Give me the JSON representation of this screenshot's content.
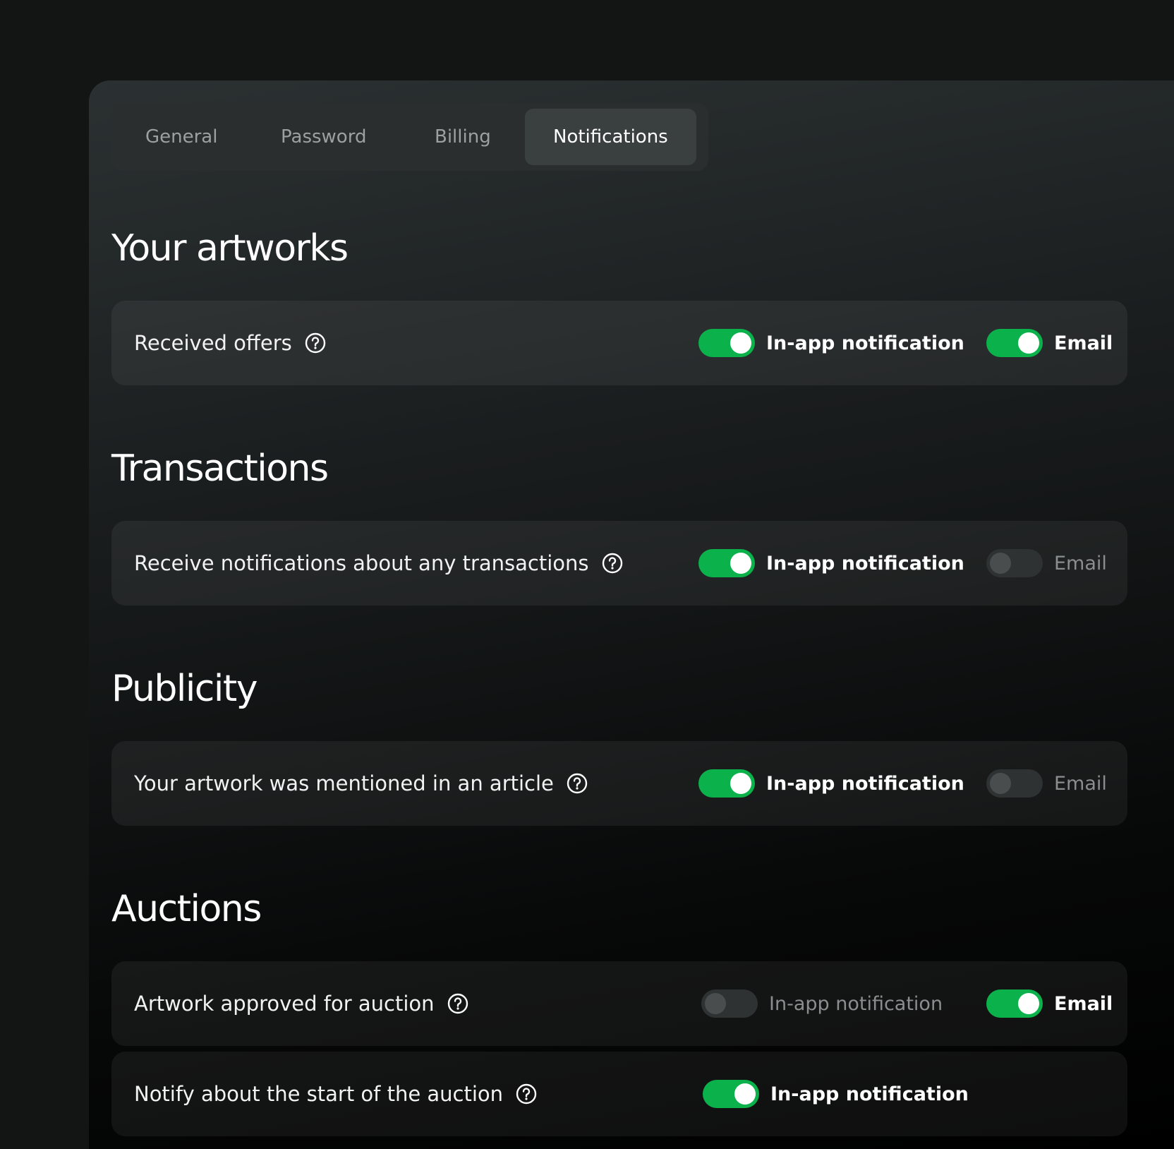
{
  "tabs": [
    {
      "label": "General",
      "active": false
    },
    {
      "label": "Password",
      "active": false
    },
    {
      "label": "Billing",
      "active": false
    },
    {
      "label": "Notifications",
      "active": true
    }
  ],
  "colors": {
    "toggle_on": "#0bb24b",
    "toggle_off": "#2f3233",
    "text_primary": "#ffffff",
    "text_muted": "#8a8e8f"
  },
  "icons": {
    "help": "question-circle-icon"
  },
  "sections": [
    {
      "title": "Your artworks",
      "rows": [
        {
          "label": "Received offers",
          "in_app": {
            "label": "In-app notification",
            "on": true
          },
          "email": {
            "label": "Email",
            "on": true
          }
        }
      ]
    },
    {
      "title": "Transactions",
      "rows": [
        {
          "label": "Receive notifications about any transactions",
          "in_app": {
            "label": "In-app notification",
            "on": true
          },
          "email": {
            "label": "Email",
            "on": false
          }
        }
      ]
    },
    {
      "title": "Publicity",
      "rows": [
        {
          "label": "Your artwork was mentioned in an article",
          "in_app": {
            "label": "In-app notification",
            "on": true
          },
          "email": {
            "label": "Email",
            "on": false
          }
        }
      ]
    },
    {
      "title": "Auctions",
      "rows": [
        {
          "label": "Artwork approved for auction",
          "in_app": {
            "label": "In-app notification",
            "on": false
          },
          "email": {
            "label": "Email",
            "on": true
          }
        },
        {
          "label": "Notify about the start of the auction",
          "in_app": {
            "label": "In-app notification",
            "on": true
          }
        }
      ]
    }
  ]
}
